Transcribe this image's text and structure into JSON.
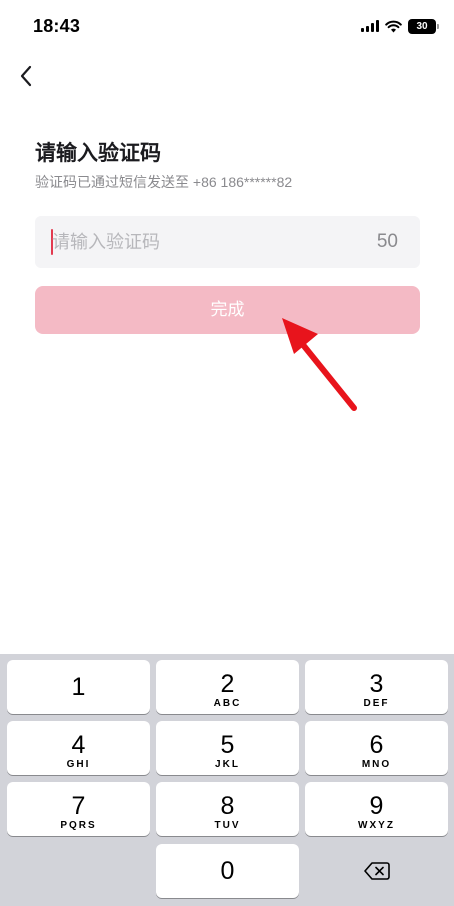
{
  "status_bar": {
    "time": "18:43",
    "battery": "30"
  },
  "verify": {
    "title": "请输入验证码",
    "subtitle": "验证码已通过短信发送至 +86 186******82",
    "input_placeholder": "请输入验证码",
    "input_value": "",
    "countdown": "50",
    "submit_label": "完成"
  },
  "keypad": {
    "keys": [
      {
        "digit": "1",
        "letters": ""
      },
      {
        "digit": "2",
        "letters": "ABC"
      },
      {
        "digit": "3",
        "letters": "DEF"
      },
      {
        "digit": "4",
        "letters": "GHI"
      },
      {
        "digit": "5",
        "letters": "JKL"
      },
      {
        "digit": "6",
        "letters": "MNO"
      },
      {
        "digit": "7",
        "letters": "PQRS"
      },
      {
        "digit": "8",
        "letters": "TUV"
      },
      {
        "digit": "9",
        "letters": "WXYZ"
      },
      {
        "digit": "0",
        "letters": ""
      }
    ]
  },
  "icons": {
    "back": "chevron-left-icon",
    "backspace": "backspace-icon",
    "annotation": "red-arrow-icon"
  },
  "colors": {
    "accent": "#e23a4f",
    "submit_disabled": "#f4bac5",
    "annotation_arrow": "#e8141c",
    "keypad_bg": "#d2d3d9"
  }
}
